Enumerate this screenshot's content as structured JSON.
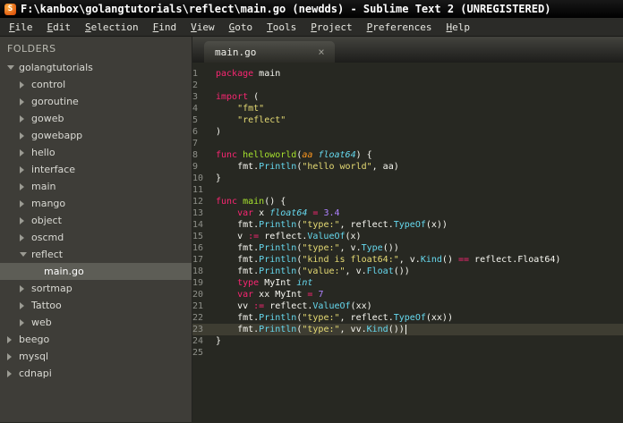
{
  "window": {
    "title": "F:\\kanbox\\golangtutorials\\reflect\\main.go (newdds) - Sublime Text 2 (UNREGISTERED)",
    "app_icon_glyph": "S"
  },
  "menu": {
    "items": [
      "File",
      "Edit",
      "Selection",
      "Find",
      "View",
      "Goto",
      "Tools",
      "Project",
      "Preferences",
      "Help"
    ]
  },
  "sidebar": {
    "header": "FOLDERS",
    "items": [
      {
        "label": "golangtutorials",
        "level": 0,
        "arrow": "down",
        "selected": false
      },
      {
        "label": "control",
        "level": 1,
        "arrow": "right",
        "selected": false
      },
      {
        "label": "goroutine",
        "level": 1,
        "arrow": "right",
        "selected": false
      },
      {
        "label": "goweb",
        "level": 1,
        "arrow": "right",
        "selected": false
      },
      {
        "label": "gowebapp",
        "level": 1,
        "arrow": "right",
        "selected": false
      },
      {
        "label": "hello",
        "level": 1,
        "arrow": "right",
        "selected": false
      },
      {
        "label": "interface",
        "level": 1,
        "arrow": "right",
        "selected": false
      },
      {
        "label": "main",
        "level": 1,
        "arrow": "right",
        "selected": false
      },
      {
        "label": "mango",
        "level": 1,
        "arrow": "right",
        "selected": false
      },
      {
        "label": "object",
        "level": 1,
        "arrow": "right",
        "selected": false
      },
      {
        "label": "oscmd",
        "level": 1,
        "arrow": "right",
        "selected": false
      },
      {
        "label": "reflect",
        "level": 1,
        "arrow": "down",
        "selected": false
      },
      {
        "label": "main.go",
        "level": 2,
        "arrow": null,
        "selected": true
      },
      {
        "label": "sortmap",
        "level": 1,
        "arrow": "right",
        "selected": false
      },
      {
        "label": "Tattoo",
        "level": 1,
        "arrow": "right",
        "selected": false
      },
      {
        "label": "web",
        "level": 1,
        "arrow": "right",
        "selected": false
      },
      {
        "label": "beego",
        "level": 0,
        "arrow": "right",
        "selected": false
      },
      {
        "label": "mysql",
        "level": 0,
        "arrow": "right",
        "selected": false
      },
      {
        "label": "cdnapi",
        "level": 0,
        "arrow": "right",
        "selected": false
      }
    ]
  },
  "editor": {
    "tab": {
      "label": "main.go",
      "close_glyph": "×"
    },
    "active_line": 23,
    "lines": [
      {
        "n": 1,
        "t": [
          [
            "package",
            "k"
          ],
          [
            " main",
            "w"
          ]
        ]
      },
      {
        "n": 2,
        "t": []
      },
      {
        "n": 3,
        "t": [
          [
            "import",
            "k"
          ],
          [
            " (",
            "w"
          ]
        ]
      },
      {
        "n": 4,
        "t": [
          [
            "    ",
            "w"
          ],
          [
            "\"fmt\"",
            "s"
          ]
        ]
      },
      {
        "n": 5,
        "t": [
          [
            "    ",
            "w"
          ],
          [
            "\"reflect\"",
            "s"
          ]
        ]
      },
      {
        "n": 6,
        "t": [
          [
            ")",
            "w"
          ]
        ]
      },
      {
        "n": 7,
        "t": []
      },
      {
        "n": 8,
        "t": [
          [
            "func",
            "k"
          ],
          [
            " ",
            "w"
          ],
          [
            "helloworld",
            "g"
          ],
          [
            "(",
            "w"
          ],
          [
            "aa",
            "o"
          ],
          [
            " ",
            "w"
          ],
          [
            "float64",
            "t"
          ],
          [
            ") {",
            "w"
          ]
        ]
      },
      {
        "n": 9,
        "t": [
          [
            "    fmt.",
            "w"
          ],
          [
            "Println",
            "f"
          ],
          [
            "(",
            "w"
          ],
          [
            "\"hello world\"",
            "s"
          ],
          [
            ", aa)",
            "w"
          ]
        ]
      },
      {
        "n": 10,
        "t": [
          [
            "}",
            "w"
          ]
        ]
      },
      {
        "n": 11,
        "t": []
      },
      {
        "n": 12,
        "t": [
          [
            "func",
            "k"
          ],
          [
            " ",
            "w"
          ],
          [
            "main",
            "g"
          ],
          [
            "() {",
            "w"
          ]
        ]
      },
      {
        "n": 13,
        "t": [
          [
            "    ",
            "w"
          ],
          [
            "var",
            "k"
          ],
          [
            " x ",
            "w"
          ],
          [
            "float64",
            "t"
          ],
          [
            " ",
            "w"
          ],
          [
            "=",
            "k"
          ],
          [
            " ",
            "w"
          ],
          [
            "3.4",
            "n"
          ]
        ]
      },
      {
        "n": 14,
        "t": [
          [
            "    fmt.",
            "w"
          ],
          [
            "Println",
            "f"
          ],
          [
            "(",
            "w"
          ],
          [
            "\"type:\"",
            "s"
          ],
          [
            ", reflect.",
            "w"
          ],
          [
            "TypeOf",
            "f"
          ],
          [
            "(x))",
            "w"
          ]
        ]
      },
      {
        "n": 15,
        "t": [
          [
            "    v ",
            "w"
          ],
          [
            ":=",
            "k"
          ],
          [
            " reflect.",
            "w"
          ],
          [
            "ValueOf",
            "f"
          ],
          [
            "(x)",
            "w"
          ]
        ]
      },
      {
        "n": 16,
        "t": [
          [
            "    fmt.",
            "w"
          ],
          [
            "Println",
            "f"
          ],
          [
            "(",
            "w"
          ],
          [
            "\"type:\"",
            "s"
          ],
          [
            ", v.",
            "w"
          ],
          [
            "Type",
            "f"
          ],
          [
            "())",
            "w"
          ]
        ]
      },
      {
        "n": 17,
        "t": [
          [
            "    fmt.",
            "w"
          ],
          [
            "Println",
            "f"
          ],
          [
            "(",
            "w"
          ],
          [
            "\"kind is float64:\"",
            "s"
          ],
          [
            ", v.",
            "w"
          ],
          [
            "Kind",
            "f"
          ],
          [
            "() ",
            "w"
          ],
          [
            "==",
            "k"
          ],
          [
            " reflect.Float64)",
            "w"
          ]
        ]
      },
      {
        "n": 18,
        "t": [
          [
            "    fmt.",
            "w"
          ],
          [
            "Println",
            "f"
          ],
          [
            "(",
            "w"
          ],
          [
            "\"value:\"",
            "s"
          ],
          [
            ", v.",
            "w"
          ],
          [
            "Float",
            "f"
          ],
          [
            "())",
            "w"
          ]
        ]
      },
      {
        "n": 19,
        "t": [
          [
            "    ",
            "w"
          ],
          [
            "type",
            "k"
          ],
          [
            " MyInt ",
            "w"
          ],
          [
            "int",
            "t"
          ]
        ]
      },
      {
        "n": 20,
        "t": [
          [
            "    ",
            "w"
          ],
          [
            "var",
            "k"
          ],
          [
            " xx MyInt ",
            "w"
          ],
          [
            "=",
            "k"
          ],
          [
            " ",
            "w"
          ],
          [
            "7",
            "n"
          ]
        ]
      },
      {
        "n": 21,
        "t": [
          [
            "    vv ",
            "w"
          ],
          [
            ":=",
            "k"
          ],
          [
            " reflect.",
            "w"
          ],
          [
            "ValueOf",
            "f"
          ],
          [
            "(xx)",
            "w"
          ]
        ]
      },
      {
        "n": 22,
        "t": [
          [
            "    fmt.",
            "w"
          ],
          [
            "Println",
            "f"
          ],
          [
            "(",
            "w"
          ],
          [
            "\"type:\"",
            "s"
          ],
          [
            ", reflect.",
            "w"
          ],
          [
            "TypeOf",
            "f"
          ],
          [
            "(xx))",
            "w"
          ]
        ]
      },
      {
        "n": 23,
        "hl": true,
        "cursor": true,
        "t": [
          [
            "    fmt.",
            "w"
          ],
          [
            "Println",
            "f"
          ],
          [
            "(",
            "w"
          ],
          [
            "\"type:\"",
            "s"
          ],
          [
            ", vv.",
            "w"
          ],
          [
            "Kind",
            "f"
          ],
          [
            "())",
            "w"
          ]
        ]
      },
      {
        "n": 24,
        "t": [
          [
            "}",
            "w"
          ]
        ]
      },
      {
        "n": 25,
        "t": []
      }
    ]
  },
  "colors": {
    "editor_bg": "#272822",
    "sidebar_bg": "#3e3d38",
    "sidebar_selected_bg": "#5d5d56",
    "active_line_bg": "#3e3d32",
    "line_number": "#8f908a",
    "keyword": "#f92672",
    "string": "#e6db74",
    "function_call": "#66d9ef",
    "type_name": "#66d9ef",
    "function_definition": "#a6e22e",
    "number": "#ae81ff",
    "parameter": "#fd971f",
    "default_text": "#f8f8f2"
  }
}
